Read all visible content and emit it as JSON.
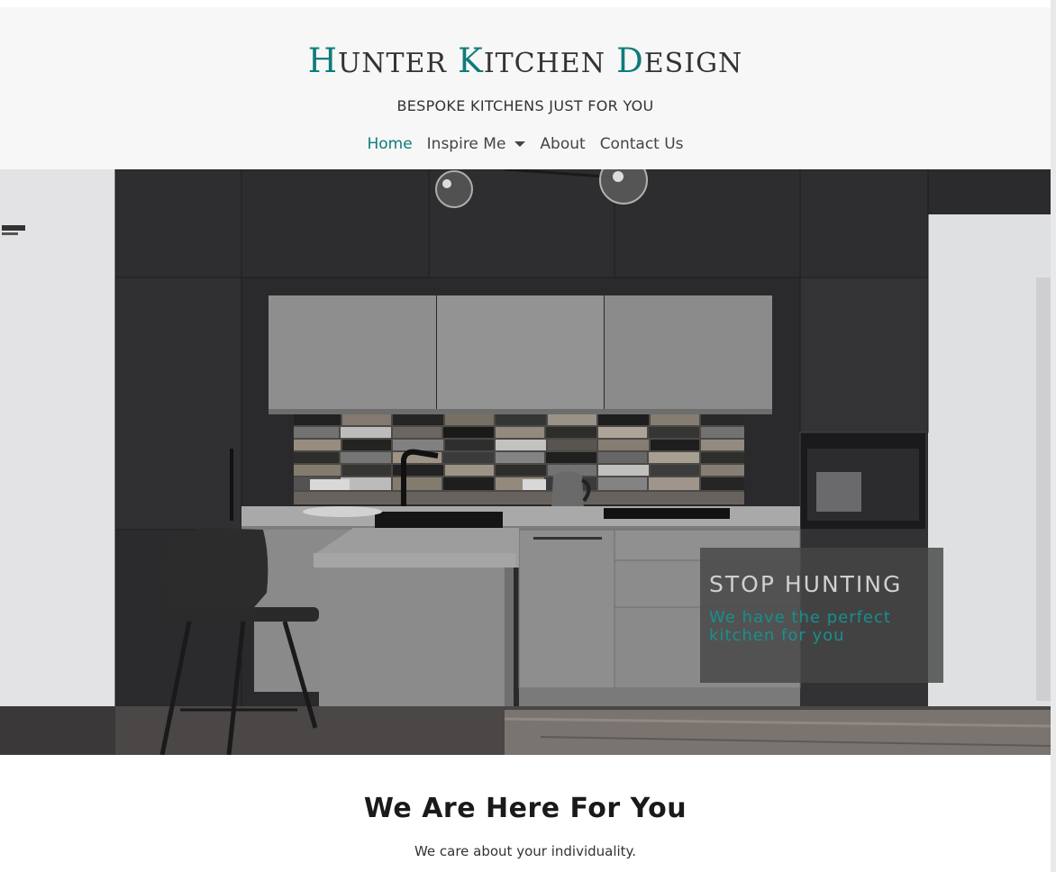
{
  "header": {
    "brand": {
      "word1_cap": "H",
      "word1_rest": "UNTER",
      "word2_cap": "K",
      "word2_rest": "ITCHEN",
      "word3_cap": "D",
      "word3_rest": "ESIGN"
    },
    "tagline": "BESPOKE KITCHENS JUST FOR YOU"
  },
  "nav": {
    "items": [
      {
        "label": "Home",
        "active": true
      },
      {
        "label": "Inspire Me",
        "dropdown": true
      },
      {
        "label": "About"
      },
      {
        "label": "Contact Us"
      }
    ]
  },
  "hero": {
    "title": "STOP HUNTING",
    "subtitle": "We have the perfect kitchen for you",
    "image_icon": "kitchen-photo"
  },
  "intro": {
    "title": "We Are Here For You",
    "subtitle": "We care about your individuality."
  },
  "colors": {
    "accent": "#0e7c7b",
    "header_bg": "#f7f7f7",
    "text": "#333333"
  }
}
